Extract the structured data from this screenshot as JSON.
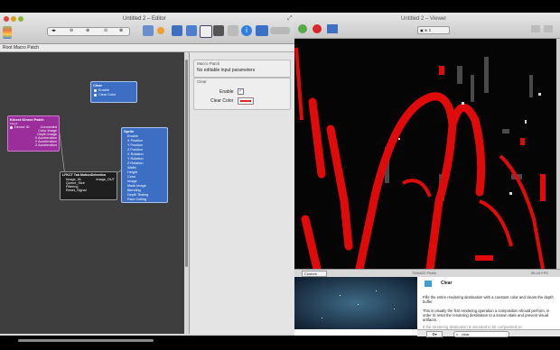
{
  "editor": {
    "title": "Untitled 2 – Editor",
    "breadcrumb": "Root Macro Patch",
    "toolbar_icons": [
      "patch-library-icon",
      "back-forward-icon",
      "zoom-out-icon",
      "zoom-in-icon",
      "zoom-reset-icon",
      "patch-creator-icon",
      "parameters-icon",
      "inspector-icon",
      "viewer-icon",
      "info-icon",
      "blue-panel-icon",
      "toggle-icon"
    ]
  },
  "patches": {
    "clear": {
      "title": "Clear",
      "inputs": [
        "Enable",
        "Clear Color"
      ],
      "color": "#3c6fc4"
    },
    "kinect": {
      "title": "Kinect Kinect Patch",
      "subtitle": "Kinect",
      "inputs": [
        "Device ID"
      ],
      "outputs": [
        "Connected",
        "Color Image",
        "Depth Image",
        "X Acceleration",
        "Y Acceleration",
        "Z Acceleration"
      ],
      "color": "#9a2e9a"
    },
    "sprite": {
      "title": "Sprite",
      "inputs": [
        "Enable",
        "X Position",
        "Y Position",
        "Z Position",
        "X Rotation",
        "Y Rotation",
        "Z Rotation",
        "Width",
        "Height",
        "Color",
        "Image",
        "Mask Image",
        "Blending",
        "Depth Testing",
        "Face Culling"
      ],
      "color": "#3c6fc4"
    },
    "motion": {
      "title": "LFKCT Tab MotionDetection",
      "inputs": [
        "Image_IN",
        "Queue_Size",
        "Filtering",
        "Reset_Signal"
      ],
      "outputs": [
        "Image_OUT"
      ],
      "color": "#1f1f1f"
    }
  },
  "inspector": {
    "macro_title": "Macro Patch",
    "macro_msg": "No editable input parameters",
    "clear_title": "Clear",
    "enable_label": "Enable",
    "enable_checked": true,
    "clear_color_label": "Clear Color",
    "clear_color": "#e02020"
  },
  "viewer": {
    "title": "Untitled 2 – Viewer",
    "render_mode": "Render",
    "status_left": "Custom",
    "status_center": "754x622 Pixels",
    "status_right": "58.45 FPS"
  },
  "help": {
    "patch_name": "Clear",
    "description_1": "Fills the entire rendering destination with a constant color and clears the depth buffer.",
    "description_2": "This is usually the first rendering operation a composition should perform, in order to reset the rendering destination to a known state and prevent visual artifacts.",
    "description_3": "If the rendering destination is intended to be composited on",
    "search_value": "clear"
  }
}
